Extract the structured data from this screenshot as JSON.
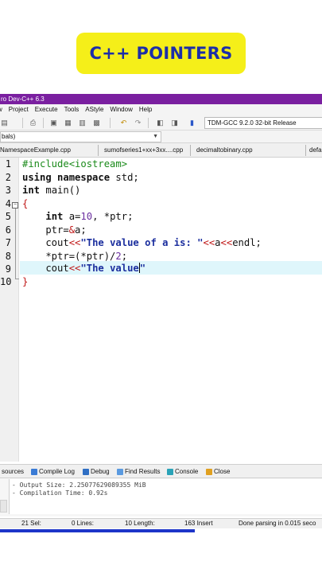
{
  "banner": {
    "title": "C++ POINTERS"
  },
  "window": {
    "title": "ro Dev-C++ 6.3"
  },
  "menu": [
    "w",
    "Project",
    "Execute",
    "Tools",
    "AStyle",
    "Window",
    "Help"
  ],
  "toolbar": {
    "compiler": "TDM-GCC 9.2.0 32-bit Release"
  },
  "combo": {
    "value": "bals)"
  },
  "tabs": [
    "NamespaceExample.cpp",
    "sumofseries1+xx+3xx....cpp",
    "decimaltobinary.cpp",
    "defa"
  ],
  "editor": {
    "line_numbers": [
      "1",
      "2",
      "3",
      "4",
      "5",
      "6",
      "7",
      "8",
      "9",
      "10"
    ],
    "lines": {
      "l1": "#include<iostream>",
      "l2a": "using namespace",
      "l2b": " std;",
      "l3a": "int",
      "l3b": " main()",
      "l4": "{",
      "l5a": "    ",
      "l5b": "int",
      "l5c": " a=",
      "l5d": "10",
      "l5e": ", *ptr;",
      "l6a": "    ptr=",
      "l6b": "&",
      "l6c": "a;",
      "l7a": "    cout",
      "l7b": "<<",
      "l7c": "\"The value of a is: \"",
      "l7d": "<<",
      "l7e": "a",
      "l7f": "<<",
      "l7g": "endl;",
      "l8a": "    *ptr=(*ptr)/",
      "l8b": "2",
      "l8c": ";",
      "l9a": "    cout",
      "l9b": "<<",
      "l9c": "\"The value",
      "l9d": "\"",
      "l10": "}"
    }
  },
  "panel": {
    "tabs": [
      "sources",
      "Compile Log",
      "Debug",
      "Find Results",
      "Console",
      "Close"
    ],
    "log": [
      "- Output Size: 2.25077629089355 MiB",
      "- Compilation Time: 0.92s"
    ]
  },
  "status": {
    "sel": "21 Sel:",
    "lines": "0 Lines:",
    "length": "10 Length:",
    "insert": "163 Insert",
    "parsing": "Done parsing in 0.015 seco"
  },
  "colors": {
    "banner_bg": "#f5ef19",
    "banner_text": "#1c2ea8",
    "titlebar": "#7a1fa0",
    "current_line": "#dff6fb",
    "progress": "#1d35c9"
  },
  "icons": {
    "toolbar": [
      "new-file-icon",
      "print-icon",
      "compile-icon",
      "run-icon",
      "undo-icon",
      "redo-icon",
      "bookmark-icon"
    ],
    "panel": [
      "sources-icon",
      "compile-log-icon",
      "debug-icon",
      "find-results-icon",
      "console-icon",
      "close-icon"
    ]
  }
}
